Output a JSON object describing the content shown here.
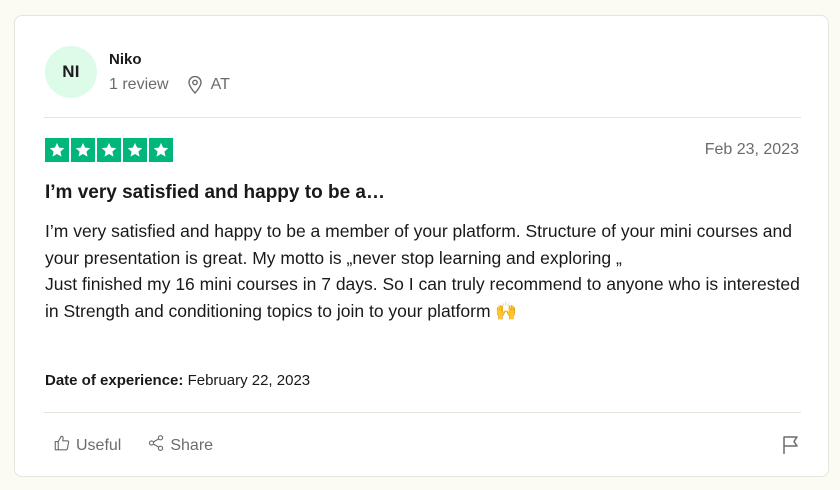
{
  "reviewer": {
    "initials": "NI",
    "name": "Niko",
    "review_count": "1 review",
    "country": "AT",
    "avatar_bg": "#dcfce9"
  },
  "rating": {
    "stars": 5,
    "max": 5,
    "color": "#00b67a"
  },
  "review": {
    "date": "Feb 23, 2023",
    "title": "I’m very satisfied and happy to be a…",
    "paragraph1": "I’m very satisfied and happy to be a member of your platform. Structure of your mini courses and your presentation is great. My motto is „never stop learning and exploring „",
    "paragraph2": "Just finished my 16 mini courses in 7 days. So I can truly recommend to anyone who is interested in Strength and conditioning topics to join to your platform 🙌",
    "experience_label": "Date of experience:",
    "experience_date": "February 22, 2023"
  },
  "actions": {
    "useful_label": "Useful",
    "share_label": "Share",
    "icons": [
      "thumbs-up-icon",
      "share-icon",
      "flag-icon"
    ]
  }
}
